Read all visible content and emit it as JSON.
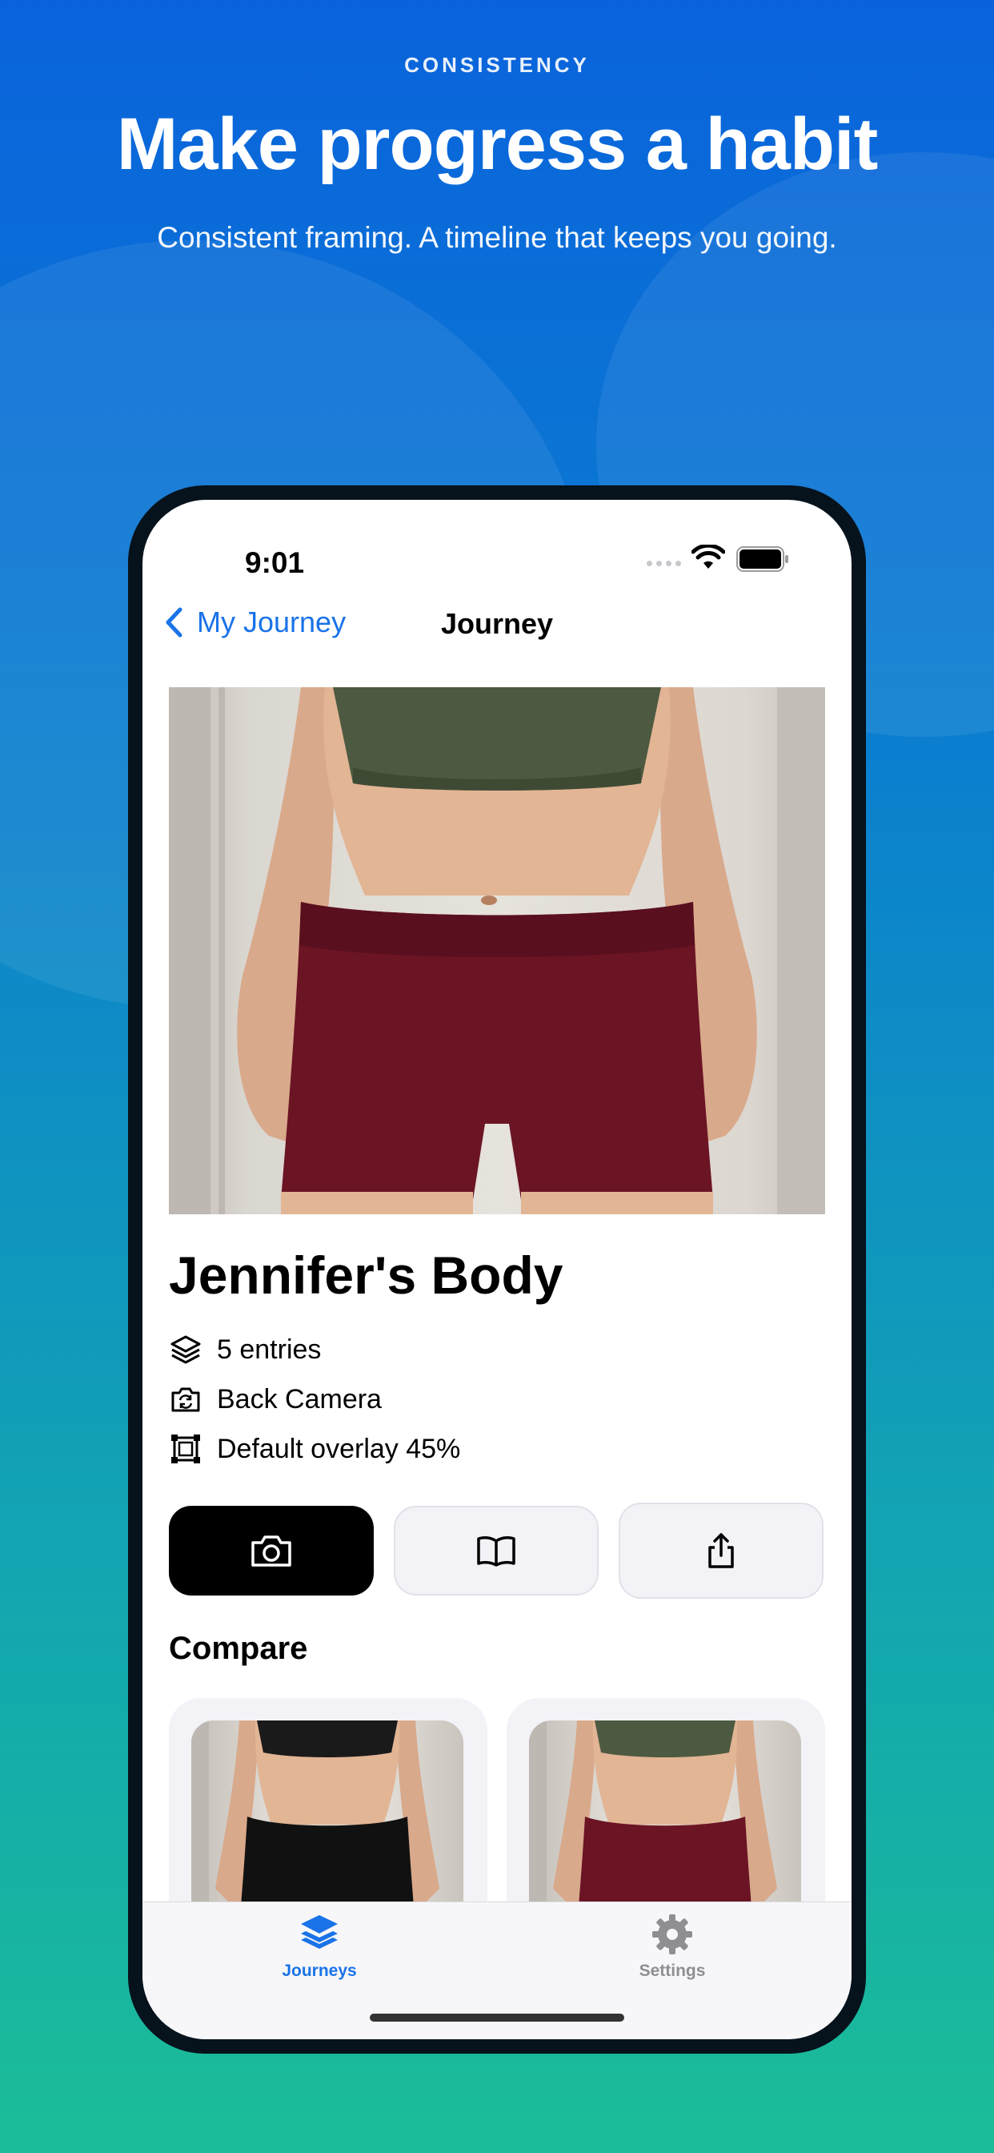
{
  "hero": {
    "eyebrow": "CONSISTENCY",
    "title": "Make progress a habit",
    "subtitle": "Consistent framing. A timeline that keeps you going."
  },
  "status_bar": {
    "time": "9:01"
  },
  "nav": {
    "back_label": "My Journey",
    "title": "Journey"
  },
  "journey": {
    "name": "Jennifer's Body",
    "entries": "5 entries",
    "camera": "Back Camera",
    "overlay": "Default overlay 45%"
  },
  "actions": [
    {
      "icon": "camera-icon",
      "style": "primary"
    },
    {
      "icon": "book-icon",
      "style": "secondary"
    },
    {
      "icon": "share-icon",
      "style": "secondary"
    }
  ],
  "compare": {
    "title": "Compare",
    "cards": [
      {
        "shorts_color": "#111111",
        "top_color": "#1a1a1a"
      },
      {
        "shorts_color": "#6b1424",
        "top_color": "#4d5a41"
      }
    ]
  },
  "tab_bar": {
    "items": [
      {
        "label": "Journeys",
        "icon": "stack-icon",
        "active": true
      },
      {
        "label": "Settings",
        "icon": "gear-icon",
        "active": false
      }
    ]
  },
  "colors": {
    "accent": "#1a73e8",
    "background_top": "#0a63dc",
    "background_bottom": "#1bbd98",
    "primary_button": "#000000",
    "inactive_tab": "#8e8e93"
  }
}
